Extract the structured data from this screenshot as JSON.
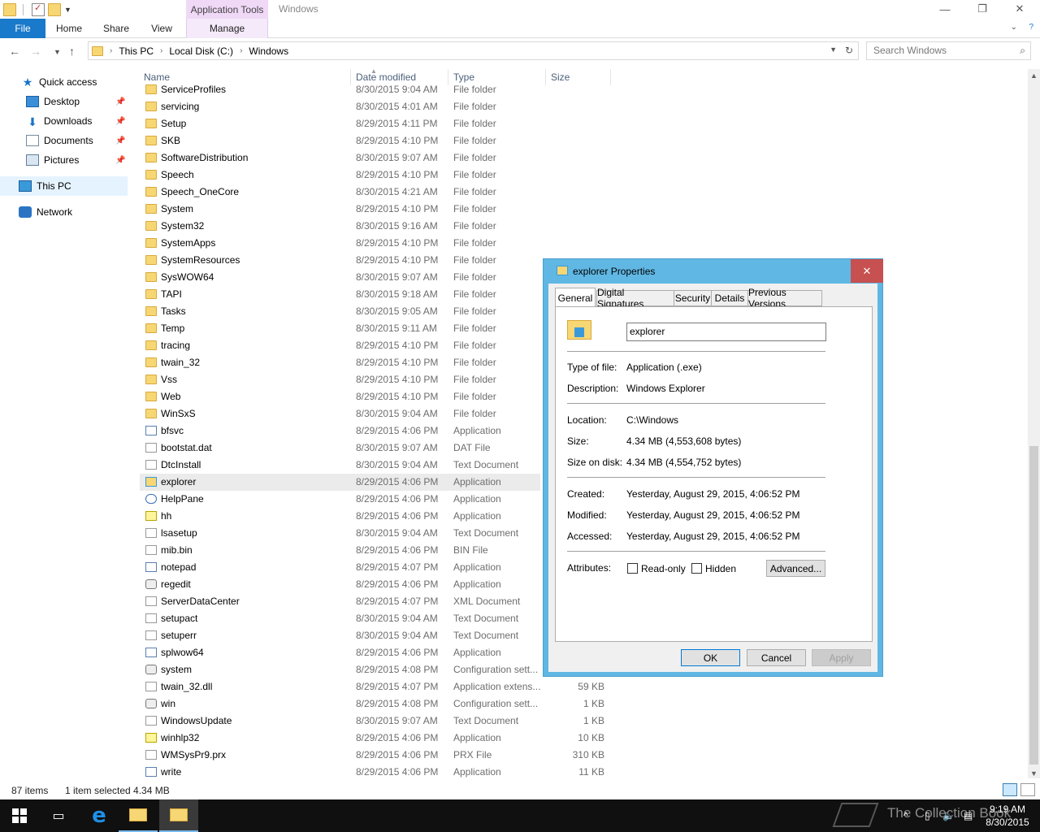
{
  "titlebar": {
    "context_tab": "Application Tools",
    "window_title": "Windows",
    "minimize": "—",
    "restore": "❐",
    "close": "✕"
  },
  "ribbon": {
    "file": "File",
    "home": "Home",
    "share": "Share",
    "view": "View",
    "manage": "Manage"
  },
  "address": {
    "crumbs": [
      "This PC",
      "Local Disk (C:)",
      "Windows"
    ],
    "search_placeholder": "Search Windows"
  },
  "nav": {
    "quick_access": "Quick access",
    "desktop": "Desktop",
    "downloads": "Downloads",
    "documents": "Documents",
    "pictures": "Pictures",
    "this_pc": "This PC",
    "network": "Network"
  },
  "columns": {
    "name": "Name",
    "date": "Date modified",
    "type": "Type",
    "size": "Size"
  },
  "files": [
    {
      "icon": "folder",
      "name": "ServiceProfiles",
      "date": "8/30/2015 9:04 AM",
      "type": "File folder",
      "size": ""
    },
    {
      "icon": "folder",
      "name": "servicing",
      "date": "8/30/2015 4:01 AM",
      "type": "File folder",
      "size": ""
    },
    {
      "icon": "folder",
      "name": "Setup",
      "date": "8/29/2015 4:11 PM",
      "type": "File folder",
      "size": ""
    },
    {
      "icon": "folder",
      "name": "SKB",
      "date": "8/29/2015 4:10 PM",
      "type": "File folder",
      "size": ""
    },
    {
      "icon": "folder",
      "name": "SoftwareDistribution",
      "date": "8/30/2015 9:07 AM",
      "type": "File folder",
      "size": ""
    },
    {
      "icon": "folder",
      "name": "Speech",
      "date": "8/29/2015 4:10 PM",
      "type": "File folder",
      "size": ""
    },
    {
      "icon": "folder",
      "name": "Speech_OneCore",
      "date": "8/30/2015 4:21 AM",
      "type": "File folder",
      "size": ""
    },
    {
      "icon": "folder",
      "name": "System",
      "date": "8/29/2015 4:10 PM",
      "type": "File folder",
      "size": ""
    },
    {
      "icon": "folder",
      "name": "System32",
      "date": "8/30/2015 9:16 AM",
      "type": "File folder",
      "size": ""
    },
    {
      "icon": "folder",
      "name": "SystemApps",
      "date": "8/29/2015 4:10 PM",
      "type": "File folder",
      "size": ""
    },
    {
      "icon": "folder",
      "name": "SystemResources",
      "date": "8/29/2015 4:10 PM",
      "type": "File folder",
      "size": ""
    },
    {
      "icon": "folder",
      "name": "SysWOW64",
      "date": "8/30/2015 9:07 AM",
      "type": "File folder",
      "size": ""
    },
    {
      "icon": "folder",
      "name": "TAPI",
      "date": "8/30/2015 9:18 AM",
      "type": "File folder",
      "size": ""
    },
    {
      "icon": "folder",
      "name": "Tasks",
      "date": "8/30/2015 9:05 AM",
      "type": "File folder",
      "size": ""
    },
    {
      "icon": "folder",
      "name": "Temp",
      "date": "8/30/2015 9:11 AM",
      "type": "File folder",
      "size": ""
    },
    {
      "icon": "folder",
      "name": "tracing",
      "date": "8/29/2015 4:10 PM",
      "type": "File folder",
      "size": ""
    },
    {
      "icon": "folder",
      "name": "twain_32",
      "date": "8/29/2015 4:10 PM",
      "type": "File folder",
      "size": ""
    },
    {
      "icon": "folder",
      "name": "Vss",
      "date": "8/29/2015 4:10 PM",
      "type": "File folder",
      "size": ""
    },
    {
      "icon": "folder",
      "name": "Web",
      "date": "8/29/2015 4:10 PM",
      "type": "File folder",
      "size": ""
    },
    {
      "icon": "folder",
      "name": "WinSxS",
      "date": "8/30/2015 9:04 AM",
      "type": "File folder",
      "size": ""
    },
    {
      "icon": "app",
      "name": "bfsvc",
      "date": "8/29/2015 4:06 PM",
      "type": "Application",
      "size": ""
    },
    {
      "icon": "doc",
      "name": "bootstat.dat",
      "date": "8/30/2015 9:07 AM",
      "type": "DAT File",
      "size": ""
    },
    {
      "icon": "doc",
      "name": "DtcInstall",
      "date": "8/30/2015 9:04 AM",
      "type": "Text Document",
      "size": ""
    },
    {
      "icon": "exp",
      "name": "explorer",
      "date": "8/29/2015 4:06 PM",
      "type": "Application",
      "size": ""
    },
    {
      "icon": "help",
      "name": "HelpPane",
      "date": "8/29/2015 4:06 PM",
      "type": "Application",
      "size": ""
    },
    {
      "icon": "hh",
      "name": "hh",
      "date": "8/29/2015 4:06 PM",
      "type": "Application",
      "size": ""
    },
    {
      "icon": "doc",
      "name": "lsasetup",
      "date": "8/30/2015 9:04 AM",
      "type": "Text Document",
      "size": ""
    },
    {
      "icon": "doc",
      "name": "mib.bin",
      "date": "8/29/2015 4:06 PM",
      "type": "BIN File",
      "size": ""
    },
    {
      "icon": "app",
      "name": "notepad",
      "date": "8/29/2015 4:07 PM",
      "type": "Application",
      "size": ""
    },
    {
      "icon": "gear",
      "name": "regedit",
      "date": "8/29/2015 4:06 PM",
      "type": "Application",
      "size": ""
    },
    {
      "icon": "doc",
      "name": "ServerDataCenter",
      "date": "8/29/2015 4:07 PM",
      "type": "XML Document",
      "size": ""
    },
    {
      "icon": "doc",
      "name": "setupact",
      "date": "8/30/2015 9:04 AM",
      "type": "Text Document",
      "size": ""
    },
    {
      "icon": "doc",
      "name": "setuperr",
      "date": "8/30/2015 9:04 AM",
      "type": "Text Document",
      "size": ""
    },
    {
      "icon": "app",
      "name": "splwow64",
      "date": "8/29/2015 4:06 PM",
      "type": "Application",
      "size": ""
    },
    {
      "icon": "gear",
      "name": "system",
      "date": "8/29/2015 4:08 PM",
      "type": "Configuration sett...",
      "size": ""
    },
    {
      "icon": "doc",
      "name": "twain_32.dll",
      "date": "8/29/2015 4:07 PM",
      "type": "Application extens...",
      "size": "59 KB"
    },
    {
      "icon": "gear",
      "name": "win",
      "date": "8/29/2015 4:08 PM",
      "type": "Configuration sett...",
      "size": "1 KB"
    },
    {
      "icon": "doc",
      "name": "WindowsUpdate",
      "date": "8/30/2015 9:07 AM",
      "type": "Text Document",
      "size": "1 KB"
    },
    {
      "icon": "hh",
      "name": "winhlp32",
      "date": "8/29/2015 4:06 PM",
      "type": "Application",
      "size": "10 KB"
    },
    {
      "icon": "doc",
      "name": "WMSysPr9.prx",
      "date": "8/29/2015 4:06 PM",
      "type": "PRX File",
      "size": "310 KB"
    },
    {
      "icon": "app",
      "name": "write",
      "date": "8/29/2015 4:06 PM",
      "type": "Application",
      "size": "11 KB"
    }
  ],
  "status": {
    "count": "87 items",
    "selected": "1 item selected  4.34 MB"
  },
  "dialog": {
    "title": "explorer Properties",
    "tabs": [
      "General",
      "Digital Signatures",
      "Security",
      "Details",
      "Previous Versions"
    ],
    "filename": "explorer",
    "type_label": "Type of file:",
    "type_value": "Application (.exe)",
    "desc_label": "Description:",
    "desc_value": "Windows Explorer",
    "location_label": "Location:",
    "location_value": "C:\\Windows",
    "size_label": "Size:",
    "size_value": "4.34 MB (4,553,608 bytes)",
    "disk_label": "Size on disk:",
    "disk_value": "4.34 MB (4,554,752 bytes)",
    "created_label": "Created:",
    "created_value": "Yesterday, August 29, 2015, 4:06:52 PM",
    "modified_label": "Modified:",
    "modified_value": "Yesterday, August 29, 2015, 4:06:52 PM",
    "accessed_label": "Accessed:",
    "accessed_value": "Yesterday, August 29, 2015, 4:06:52 PM",
    "attributes_label": "Attributes:",
    "readonly": "Read-only",
    "hidden": "Hidden",
    "advanced": "Advanced...",
    "ok": "OK",
    "cancel": "Cancel",
    "apply": "Apply"
  },
  "taskbar": {
    "time": "9:19 AM",
    "date": "8/30/2015",
    "watermark": "The Collection Book"
  }
}
